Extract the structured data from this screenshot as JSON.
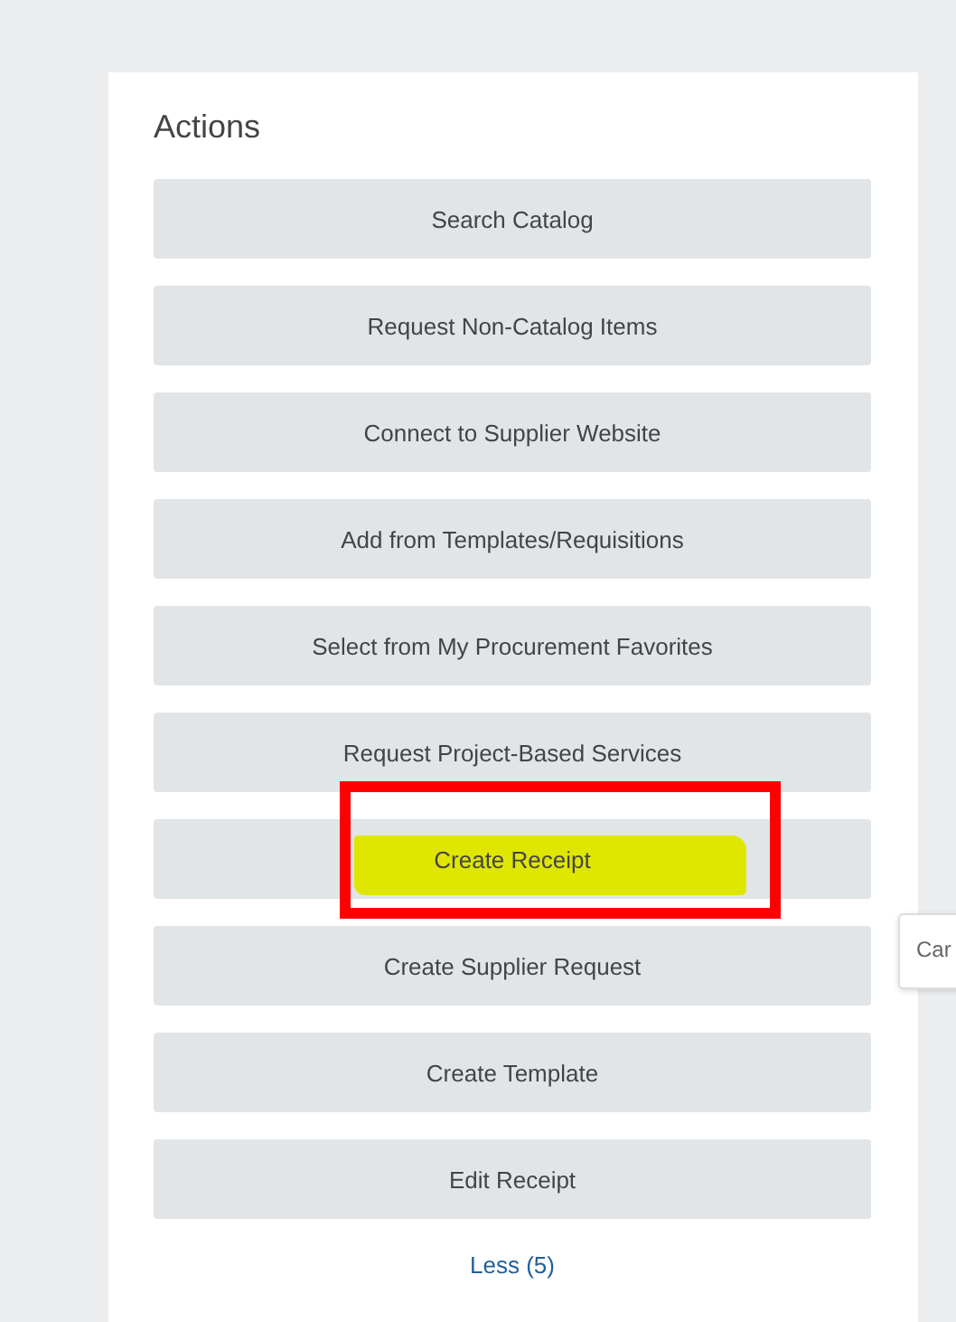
{
  "panel": {
    "title": "Actions",
    "actions": [
      {
        "label": "Search Catalog",
        "highlighted": false
      },
      {
        "label": "Request Non-Catalog Items",
        "highlighted": false
      },
      {
        "label": "Connect to Supplier Website",
        "highlighted": false
      },
      {
        "label": "Add from Templates/Requisitions",
        "highlighted": false
      },
      {
        "label": "Select from My Procurement Favorites",
        "highlighted": false
      },
      {
        "label": "Request Project-Based Services",
        "highlighted": false
      },
      {
        "label": "Create Receipt",
        "highlighted": true
      },
      {
        "label": "Create Supplier Request",
        "highlighted": false
      },
      {
        "label": "Create Template",
        "highlighted": false
      },
      {
        "label": "Edit Receipt",
        "highlighted": false
      }
    ],
    "toggle_link": "Less (5)"
  },
  "tooltip": {
    "text": "Car"
  }
}
